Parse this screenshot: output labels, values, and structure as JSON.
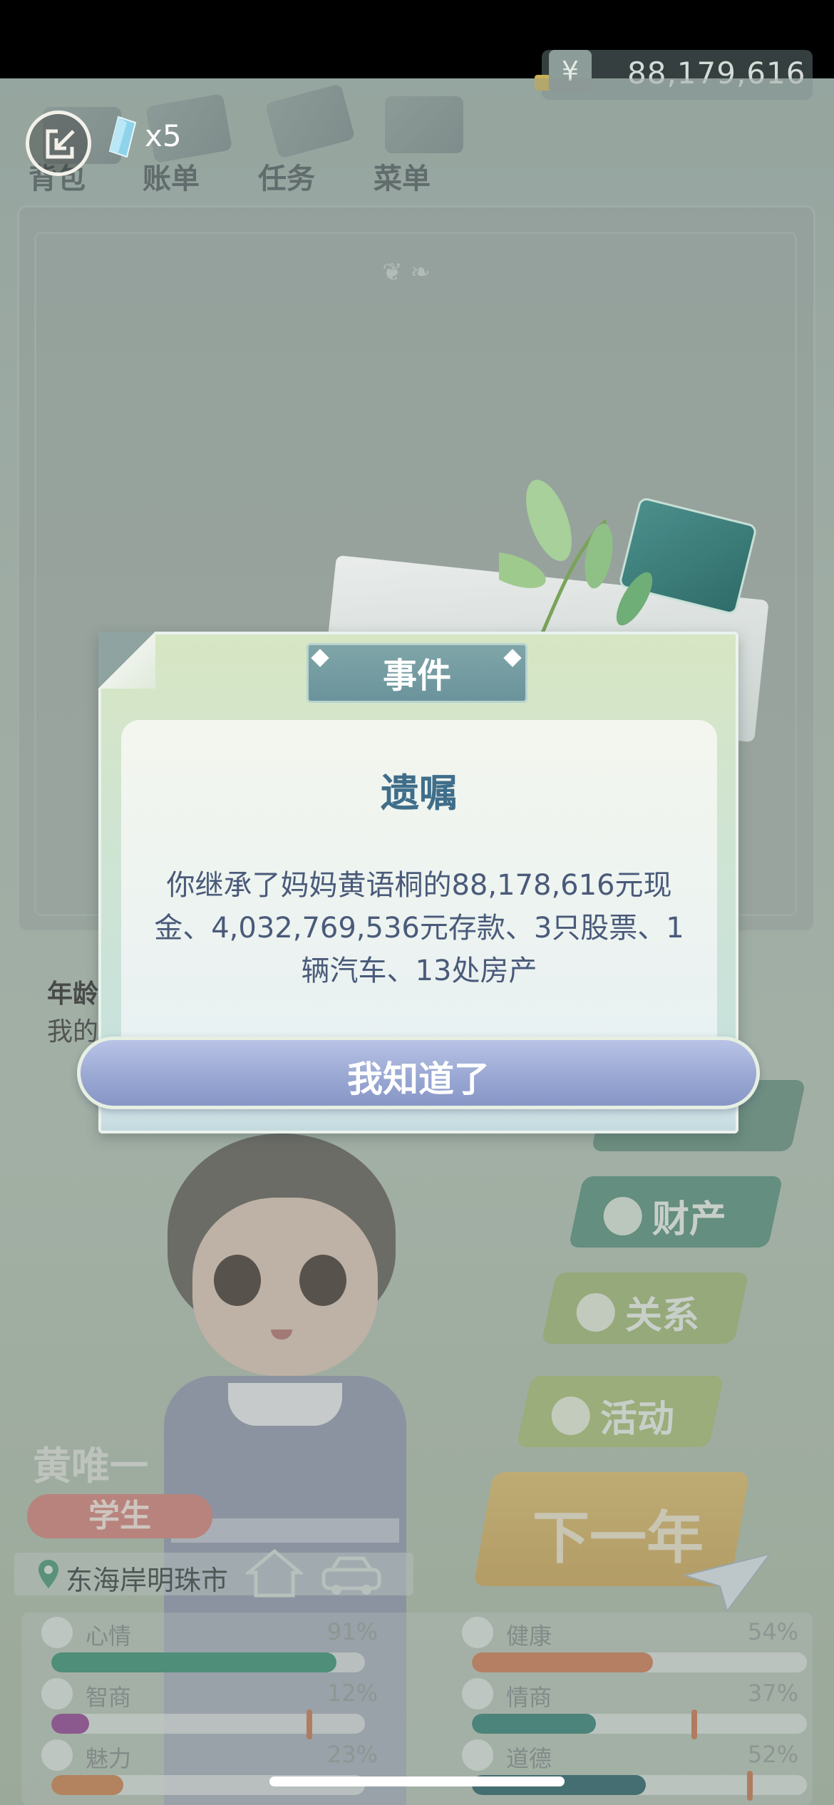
{
  "header": {
    "crystals": "x5",
    "money_symbol": "¥",
    "money": "88,179,616",
    "tabs": [
      "背包",
      "账单",
      "任务",
      "菜单"
    ]
  },
  "profile": {
    "age_label": "年龄",
    "age_text": "我的",
    "name": "黄唯一",
    "role": "学生",
    "location": "东海岸明珠市"
  },
  "actions": {
    "property": "财产",
    "relations": "关系",
    "activity": "活动",
    "next_year": "下一年"
  },
  "stats": [
    {
      "name": "心情",
      "pct": "91%",
      "value": 0.91,
      "color": "#2f8a6a",
      "icon": "smile-icon"
    },
    {
      "name": "健康",
      "pct": "54%",
      "value": 0.54,
      "color": "#c9734a",
      "icon": "heart-icon"
    },
    {
      "name": "智商",
      "pct": "12%",
      "value": 0.12,
      "color": "#8a3a8c",
      "icon": "lightbulb-icon"
    },
    {
      "name": "情商",
      "pct": "37%",
      "value": 0.37,
      "color": "#2a7a6e",
      "icon": "apple-icon"
    },
    {
      "name": "魅力",
      "pct": "23%",
      "value": 0.23,
      "color": "#c77a42",
      "icon": "sparkle-icon"
    },
    {
      "name": "道德",
      "pct": "52%",
      "value": 0.52,
      "color": "#1f5a62",
      "icon": "scales-icon"
    }
  ],
  "dialog": {
    "header": "事件",
    "title": "遗嘱",
    "message": "你继承了妈妈黄语桐的88,178,616元现金、4,032,769,536元存款、3只股票、1辆汽车、13处房产",
    "button": "我知道了"
  },
  "colors": {
    "dialog_title": "#3f6e8a",
    "button": "#9aa8d3",
    "role_badge": "#cf7a72",
    "next_year": "#d9b864"
  }
}
